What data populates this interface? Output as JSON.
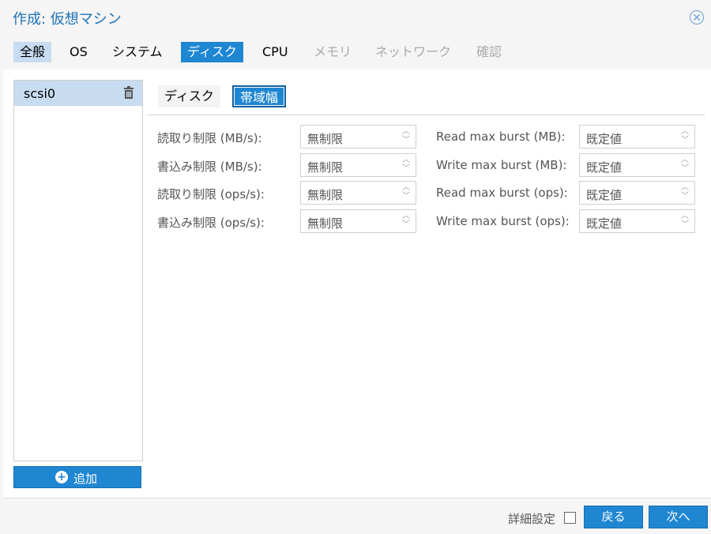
{
  "window": {
    "title": "作成: 仮想マシン",
    "close_icon": "close-circle-icon"
  },
  "tabs": [
    "全般",
    "OS",
    "システム",
    "ディスク",
    "CPU",
    "メモリ",
    "ネットワーク",
    "確認"
  ],
  "disk_list": {
    "items": [
      "scsi0"
    ],
    "delete_icon": "trash-icon",
    "add_label": "追加",
    "add_icon": "plus-circle-icon"
  },
  "subtabs": {
    "disk": "ディスク",
    "bandwidth": "帯域幅"
  },
  "bandwidth": {
    "rows": [
      {
        "label": "読取り制限 (MB/s):",
        "value": "無制限",
        "burst_label": "Read max burst (MB):",
        "burst_value": "既定値"
      },
      {
        "label": "書込み制限 (MB/s):",
        "value": "無制限",
        "burst_label": "Write max burst (MB):",
        "burst_value": "既定値"
      },
      {
        "label": "読取り制限 (ops/s):",
        "value": "無制限",
        "burst_label": "Read max burst (ops):",
        "burst_value": "既定値"
      },
      {
        "label": "書込み制限 (ops/s):",
        "value": "無制限",
        "burst_label": "Write max burst (ops):",
        "burst_value": "既定値"
      }
    ]
  },
  "footer": {
    "advanced_label": "詳細設定",
    "back_label": "戻る",
    "next_label": "次へ"
  },
  "colors": {
    "accent": "#1f86d2",
    "title": "#1f72b8",
    "selected": "#c7dcf0"
  }
}
